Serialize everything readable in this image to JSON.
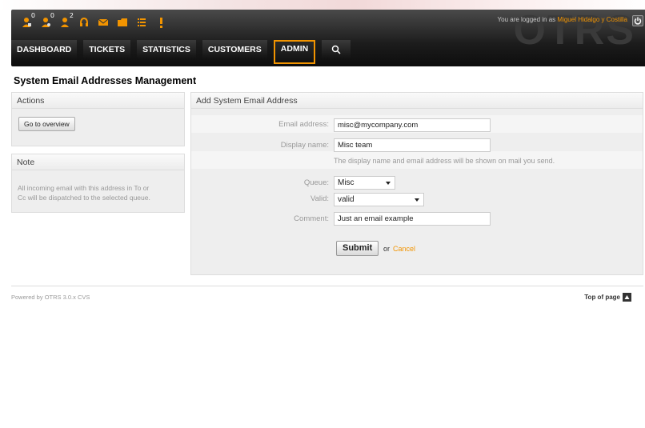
{
  "header": {
    "logo_text": "OTRS",
    "login_prefix": "You are logged in as",
    "user_name": "Miguel Hidalgo y Costilla",
    "toolbar": [
      {
        "icon": "locked-tickets-icon",
        "count": "0"
      },
      {
        "icon": "watched-tickets-icon",
        "count": "0"
      },
      {
        "icon": "responsible-tickets-icon",
        "count": "2"
      },
      {
        "icon": "phone-ticket-icon"
      },
      {
        "icon": "email-ticket-icon"
      },
      {
        "icon": "ticket-queue-icon"
      },
      {
        "icon": "ticket-status-icon"
      },
      {
        "icon": "escalation-icon"
      }
    ]
  },
  "nav": {
    "items": [
      "DASHBOARD",
      "TICKETS",
      "STATISTICS",
      "CUSTOMERS",
      "ADMIN"
    ],
    "selected": "ADMIN"
  },
  "page": {
    "title": "System Email Addresses Management"
  },
  "sidebar": {
    "actions_title": "Actions",
    "overview_button": "Go to overview",
    "note_title": "Note",
    "note_line1": "All incoming email with this address in To or",
    "note_line2": "Cc will be dispatched to the selected queue."
  },
  "form": {
    "title": "Add System Email Address",
    "email_label": "Email address:",
    "email_value": "misc@mycompany.com",
    "name_label": "Display name:",
    "name_value": "Misc team",
    "name_hint": "The display name and email address will be shown on mail you send.",
    "queue_label": "Queue:",
    "queue_value": "Misc",
    "valid_label": "Valid:",
    "valid_value": "valid",
    "comment_label": "Comment:",
    "comment_value": "Just an email example",
    "submit_label": "Submit",
    "or_text": "or",
    "cancel_label": "Cancel"
  },
  "footer": {
    "powered_by": "Powered by OTRS 3.0.x CVS",
    "top_link": "Top of page"
  },
  "colors": {
    "accent": "#f29400",
    "header_dark": "#1c1c1c",
    "widget_bg": "#eeeeee"
  }
}
